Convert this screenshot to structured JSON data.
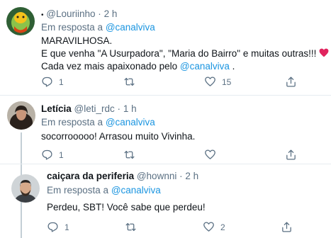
{
  "tweets": [
    {
      "prefix": "•",
      "name": "",
      "handle": "@Louriinho",
      "dot": "·",
      "time": "2 h",
      "reply_prefix": "Em resposta a",
      "reply_to": "@canalviva",
      "lines": [
        "MARAVILHOSA.",
        "E que venha \"A Usurpadora\", \"Maria do Bairro\" e muitas outras!!!"
      ],
      "line3_text": "Cada vez mais apaixonado pelo",
      "line3_mention": "@canalviva",
      "line3_end": ".",
      "reply_count": "1",
      "retweet_count": "",
      "like_count": "15"
    },
    {
      "name": "Letícia",
      "handle": "@leti_rdc",
      "dot": "·",
      "time": "1 h",
      "reply_prefix": "Em resposta a",
      "reply_to": "@canalviva",
      "text": "socorrooooo! Arrasou muito Vivinha.",
      "reply_count": "1",
      "retweet_count": "",
      "like_count": ""
    },
    {
      "name": "caiçara da periferia",
      "handle": "@hownni",
      "dot": "·",
      "time": "2 h",
      "reply_prefix": "Em resposta a",
      "reply_to": "@canalviva",
      "text": "Perdeu, SBT! Você sabe que perdeu!",
      "reply_count": "1",
      "retweet_count": "",
      "like_count": "2"
    }
  ],
  "colors": {
    "link": "#1b95e0",
    "muted": "#5b7083",
    "heart": "#e0245e"
  }
}
